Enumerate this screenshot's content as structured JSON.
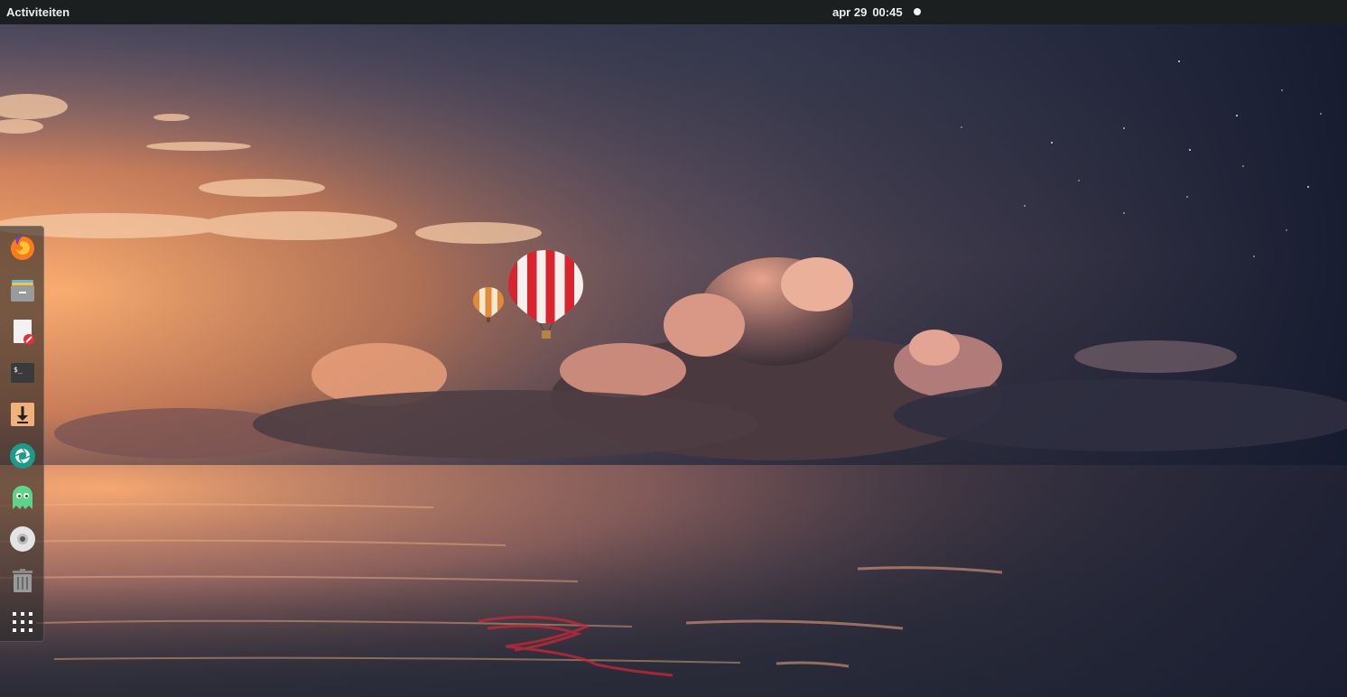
{
  "topbar": {
    "activities_label": "Activiteiten",
    "clock_date": "apr 29",
    "clock_time": "00:45"
  },
  "dock": {
    "items": [
      {
        "id": "firefox",
        "icon": "firefox-icon"
      },
      {
        "id": "files",
        "icon": "files-icon"
      },
      {
        "id": "text-editor",
        "icon": "text-editor-icon"
      },
      {
        "id": "terminal",
        "icon": "terminal-icon",
        "glyph": "$_"
      },
      {
        "id": "downloader",
        "icon": "download-icon"
      },
      {
        "id": "screenshot",
        "icon": "camera-shutter-icon"
      },
      {
        "id": "ghost-app",
        "icon": "ghost-icon"
      },
      {
        "id": "disc",
        "icon": "disc-icon"
      },
      {
        "id": "trash",
        "icon": "trash-icon"
      },
      {
        "id": "show-applications",
        "icon": "app-grid-icon"
      }
    ]
  },
  "colors": {
    "topbar_bg": "#1c1f20",
    "sky_sunset": "#f09a5a",
    "sky_night": "#1d2236",
    "balloon_red": "#d9232e"
  }
}
